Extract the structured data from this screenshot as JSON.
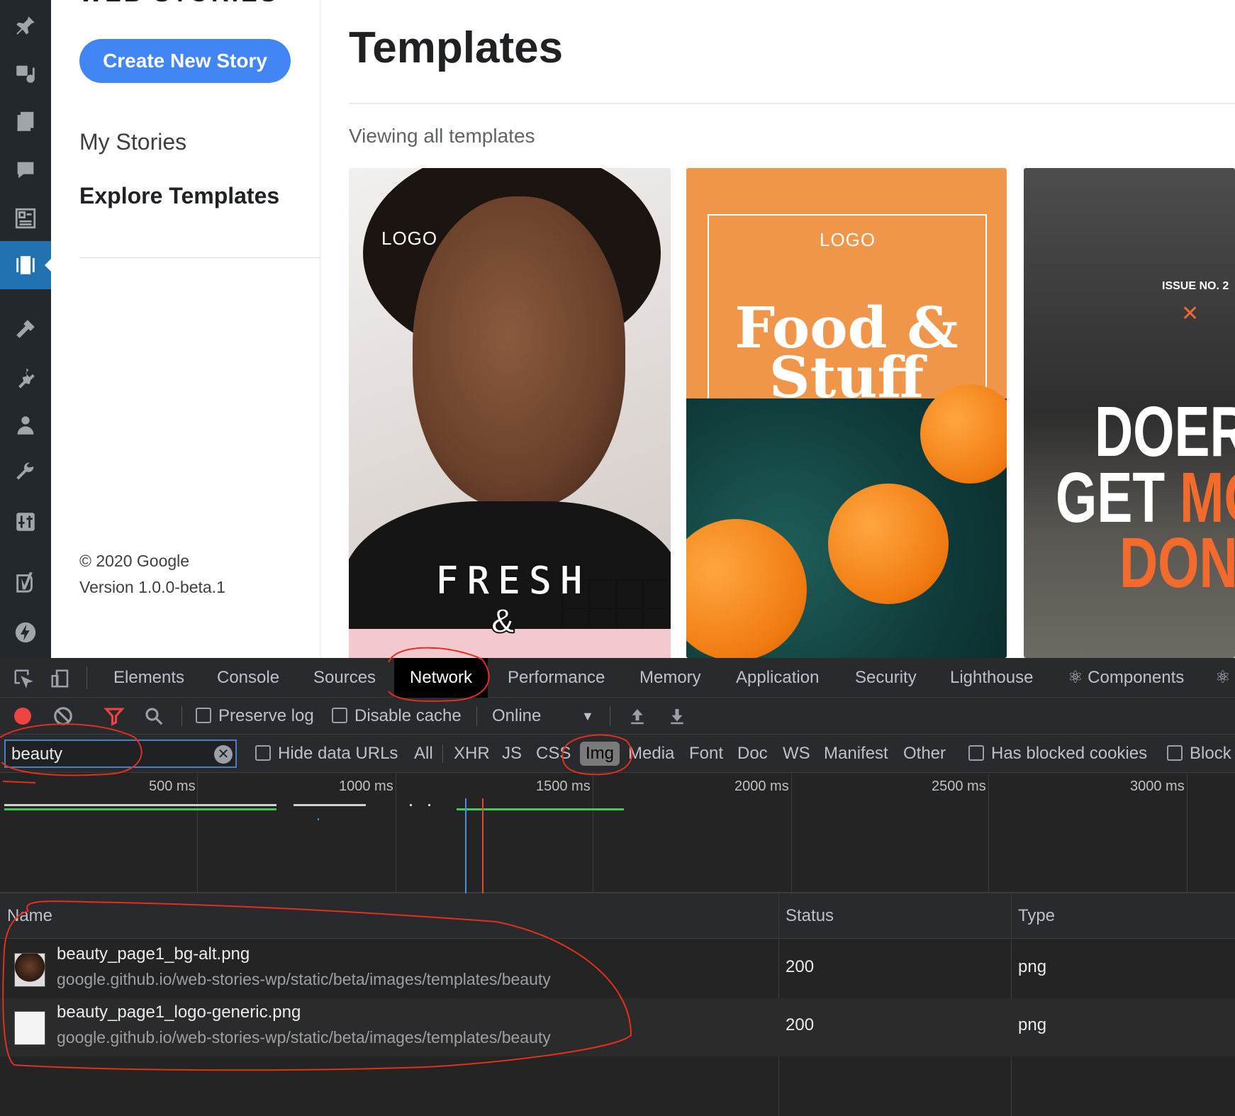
{
  "ws_sidebar": {
    "brand": "WEB STORIES",
    "create_button": "Create New Story",
    "nav": [
      "My Stories",
      "Explore Templates"
    ],
    "copyright": "© 2020 Google",
    "version": "Version 1.0.0-beta.1"
  },
  "main": {
    "title": "Templates",
    "viewing": "Viewing all templates",
    "cards": [
      {
        "logo": "LOGO",
        "title_line1": "FRESH",
        "title_line2": "&"
      },
      {
        "logo": "LOGO",
        "title": "Food & Stuff"
      },
      {
        "issue": "ISSUE NO. 2",
        "x": "✕",
        "line1": "DOERS",
        "line2a": "GET ",
        "line2b": "MORE",
        "line3": "DONE"
      }
    ]
  },
  "devtools": {
    "tabs": [
      "Elements",
      "Console",
      "Sources",
      "Network",
      "Performance",
      "Memory",
      "Application",
      "Security",
      "Lighthouse",
      "⚛ Components",
      "⚛ P"
    ],
    "active_tab": "Network",
    "toolbar": {
      "preserve_log": "Preserve log",
      "disable_cache": "Disable cache",
      "throttle": "Online"
    },
    "filter": {
      "value": "beauty",
      "hide_data_urls": "Hide data URLs",
      "types": [
        "All",
        "XHR",
        "JS",
        "CSS",
        "Img",
        "Media",
        "Font",
        "Doc",
        "WS",
        "Manifest",
        "Other"
      ],
      "active_type": "Img",
      "has_blocked_cookies": "Has blocked cookies",
      "blocked": "Block"
    },
    "timeline": {
      "ticks": [
        "500 ms",
        "1000 ms",
        "1500 ms",
        "2000 ms",
        "2500 ms",
        "3000 ms"
      ]
    },
    "table": {
      "columns": [
        "Name",
        "Status",
        "Type"
      ],
      "rows": [
        {
          "name": "beauty_page1_bg-alt.png",
          "path": "google.github.io/web-stories-wp/static/beta/images/templates/beauty",
          "status": "200",
          "type": "png"
        },
        {
          "name": "beauty_page1_logo-generic.png",
          "path": "google.github.io/web-stories-wp/static/beta/images/templates/beauty",
          "status": "200",
          "type": "png"
        }
      ]
    }
  },
  "colors": {
    "accent": "#4285f4",
    "wp_active": "#2271b1",
    "annotation": "#e0301e",
    "record": "#ef4444"
  },
  "icons": [
    "pin-icon",
    "media-icon",
    "pages-icon",
    "comments-icon",
    "forms-icon",
    "web-stories-icon",
    "appearance-icon",
    "plugins-icon",
    "users-icon",
    "tools-icon",
    "settings-icon",
    "yoast-icon",
    "amp-icon"
  ]
}
